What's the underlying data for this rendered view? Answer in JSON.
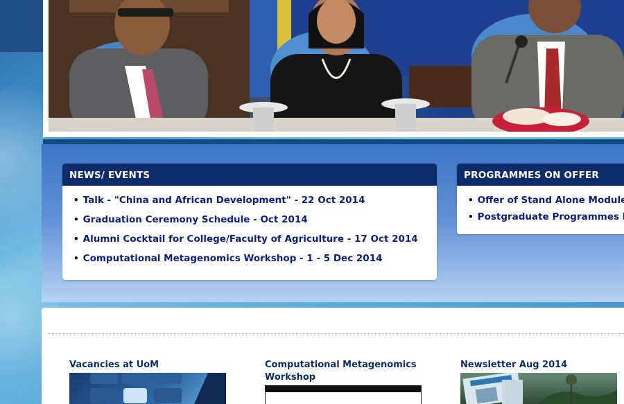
{
  "news": {
    "title": "NEWS/ EVENTS",
    "items": [
      {
        "label": "Talk - \"China and African Development\" - 22 Oct 2014"
      },
      {
        "label": "Graduation Ceremony Schedule - Oct 2014"
      },
      {
        "label": "Alumni Cocktail for College/Faculty of Agriculture - 17 Oct 2014"
      },
      {
        "label": "Computational Metagenomics Workshop - 1 - 5 Dec 2014"
      }
    ]
  },
  "programmes": {
    "title": "PROGRAMMES ON OFFER",
    "items": [
      {
        "label": "Offer of Stand Alone Modules"
      },
      {
        "label": "Postgraduate Programmes by Research"
      }
    ]
  },
  "features": {
    "vacancies_title": "Vacancies at UoM",
    "workshop_title_line1": "Computational Metagenomics",
    "workshop_title_line2": "Workshop",
    "newsletter_title": "Newsletter Aug 2014"
  },
  "colors": {
    "header_bar": "#0d2c6b",
    "link": "#0b1f7a",
    "band": "#0f4c86"
  }
}
